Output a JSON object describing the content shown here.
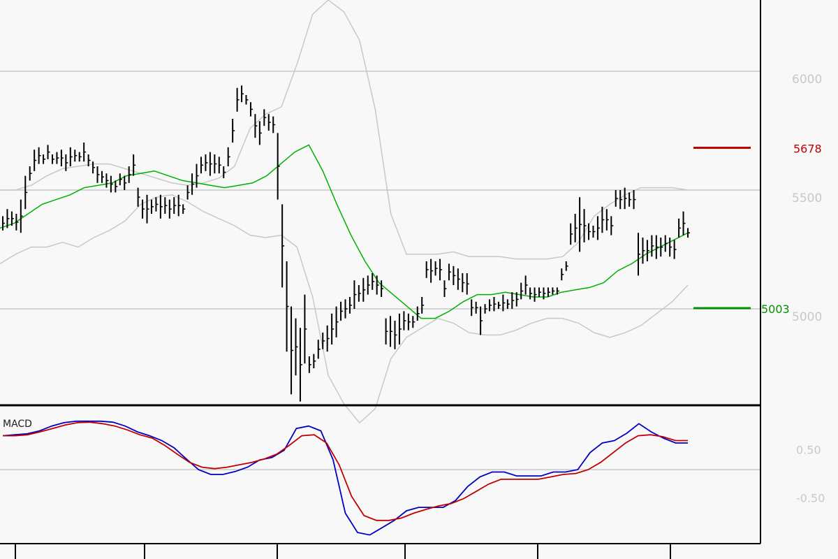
{
  "chart_data": [
    {
      "type": "ohlc",
      "title": "",
      "y_ticks": [
        "6000",
        "5500",
        "5000"
      ],
      "ylim": [
        4600,
        6300
      ],
      "levels": [
        {
          "label": "5678",
          "value": 5678,
          "color": "#c00000"
        },
        {
          "label": "5003",
          "value": 5003,
          "color": "#009000"
        }
      ],
      "bars": [
        {
          "h": 5390,
          "l": 5330
        },
        {
          "h": 5420,
          "l": 5340
        },
        {
          "h": 5410,
          "l": 5350
        },
        {
          "h": 5400,
          "l": 5330
        },
        {
          "h": 5460,
          "l": 5320
        },
        {
          "h": 5560,
          "l": 5420
        },
        {
          "h": 5600,
          "l": 5540
        },
        {
          "h": 5670,
          "l": 5580
        },
        {
          "h": 5680,
          "l": 5610
        },
        {
          "h": 5650,
          "l": 5610
        },
        {
          "h": 5690,
          "l": 5630
        },
        {
          "h": 5650,
          "l": 5610
        },
        {
          "h": 5660,
          "l": 5610
        },
        {
          "h": 5670,
          "l": 5600
        },
        {
          "h": 5650,
          "l": 5580
        },
        {
          "h": 5680,
          "l": 5600
        },
        {
          "h": 5670,
          "l": 5620
        },
        {
          "h": 5660,
          "l": 5620
        },
        {
          "h": 5700,
          "l": 5620
        },
        {
          "h": 5650,
          "l": 5600
        },
        {
          "h": 5620,
          "l": 5570
        },
        {
          "h": 5600,
          "l": 5530
        },
        {
          "h": 5580,
          "l": 5530
        },
        {
          "h": 5570,
          "l": 5510
        },
        {
          "h": 5560,
          "l": 5490
        },
        {
          "h": 5540,
          "l": 5490
        },
        {
          "h": 5570,
          "l": 5520
        },
        {
          "h": 5560,
          "l": 5500
        },
        {
          "h": 5600,
          "l": 5530
        },
        {
          "h": 5650,
          "l": 5560
        },
        {
          "h": 5510,
          "l": 5430
        },
        {
          "h": 5460,
          "l": 5380
        },
        {
          "h": 5480,
          "l": 5360
        },
        {
          "h": 5460,
          "l": 5400
        },
        {
          "h": 5470,
          "l": 5410
        },
        {
          "h": 5480,
          "l": 5380
        },
        {
          "h": 5470,
          "l": 5400
        },
        {
          "h": 5460,
          "l": 5380
        },
        {
          "h": 5470,
          "l": 5400
        },
        {
          "h": 5480,
          "l": 5390
        },
        {
          "h": 5440,
          "l": 5400
        },
        {
          "h": 5520,
          "l": 5460
        },
        {
          "h": 5570,
          "l": 5480
        },
        {
          "h": 5610,
          "l": 5510
        },
        {
          "h": 5640,
          "l": 5570
        },
        {
          "h": 5650,
          "l": 5580
        },
        {
          "h": 5660,
          "l": 5560
        },
        {
          "h": 5650,
          "l": 5570
        },
        {
          "h": 5640,
          "l": 5570
        },
        {
          "h": 5600,
          "l": 5550
        },
        {
          "h": 5680,
          "l": 5600
        },
        {
          "h": 5800,
          "l": 5700
        },
        {
          "h": 5930,
          "l": 5830
        },
        {
          "h": 5940,
          "l": 5870
        },
        {
          "h": 5900,
          "l": 5860
        },
        {
          "h": 5870,
          "l": 5810
        },
        {
          "h": 5820,
          "l": 5720
        },
        {
          "h": 5790,
          "l": 5690
        },
        {
          "h": 5840,
          "l": 5770
        },
        {
          "h": 5820,
          "l": 5750
        },
        {
          "h": 5810,
          "l": 5740
        },
        {
          "h": 5740,
          "l": 5460
        },
        {
          "h": 5440,
          "l": 5090
        },
        {
          "h": 5200,
          "l": 4820
        },
        {
          "h": 5010,
          "l": 4640
        },
        {
          "h": 4960,
          "l": 4720
        },
        {
          "h": 4920,
          "l": 4610
        },
        {
          "h": 5060,
          "l": 4770
        },
        {
          "h": 4800,
          "l": 4730
        },
        {
          "h": 4810,
          "l": 4750
        },
        {
          "h": 4870,
          "l": 4790
        },
        {
          "h": 4900,
          "l": 4830
        },
        {
          "h": 4930,
          "l": 4820
        },
        {
          "h": 4980,
          "l": 4850
        },
        {
          "h": 5010,
          "l": 4880
        },
        {
          "h": 5030,
          "l": 4950
        },
        {
          "h": 5040,
          "l": 4960
        },
        {
          "h": 5050,
          "l": 4980
        },
        {
          "h": 5120,
          "l": 5000
        },
        {
          "h": 5100,
          "l": 5030
        },
        {
          "h": 5130,
          "l": 5030
        },
        {
          "h": 5140,
          "l": 5060
        },
        {
          "h": 5150,
          "l": 5080
        },
        {
          "h": 5140,
          "l": 5060
        },
        {
          "h": 5120,
          "l": 5050
        },
        {
          "h": 4960,
          "l": 4850
        },
        {
          "h": 4970,
          "l": 4840
        },
        {
          "h": 4950,
          "l": 4830
        },
        {
          "h": 4980,
          "l": 4850
        },
        {
          "h": 4990,
          "l": 4910
        },
        {
          "h": 4980,
          "l": 4910
        },
        {
          "h": 4970,
          "l": 4920
        },
        {
          "h": 5010,
          "l": 4950
        },
        {
          "h": 5050,
          "l": 4980
        },
        {
          "h": 5200,
          "l": 5130
        },
        {
          "h": 5210,
          "l": 5110
        },
        {
          "h": 5200,
          "l": 5140
        },
        {
          "h": 5210,
          "l": 5120
        },
        {
          "h": 5120,
          "l": 5050
        },
        {
          "h": 5190,
          "l": 5120
        },
        {
          "h": 5180,
          "l": 5100
        },
        {
          "h": 5170,
          "l": 5080
        },
        {
          "h": 5150,
          "l": 5070
        },
        {
          "h": 5150,
          "l": 5060
        },
        {
          "h": 5040,
          "l": 4970
        },
        {
          "h": 5030,
          "l": 4980
        },
        {
          "h": 5010,
          "l": 4890
        },
        {
          "h": 5020,
          "l": 4980
        },
        {
          "h": 5040,
          "l": 4990
        },
        {
          "h": 5050,
          "l": 4990
        },
        {
          "h": 5030,
          "l": 5000
        },
        {
          "h": 5060,
          "l": 4990
        },
        {
          "h": 5040,
          "l": 5000
        },
        {
          "h": 5070,
          "l": 5000
        },
        {
          "h": 5070,
          "l": 5010
        },
        {
          "h": 5110,
          "l": 5040
        },
        {
          "h": 5140,
          "l": 5060
        },
        {
          "h": 5090,
          "l": 5040
        },
        {
          "h": 5090,
          "l": 5030
        },
        {
          "h": 5090,
          "l": 5050
        },
        {
          "h": 5090,
          "l": 5040
        },
        {
          "h": 5090,
          "l": 5050
        },
        {
          "h": 5090,
          "l": 5060
        },
        {
          "h": 5090,
          "l": 5060
        },
        {
          "h": 5170,
          "l": 5120
        },
        {
          "h": 5200,
          "l": 5160
        },
        {
          "h": 5360,
          "l": 5270
        },
        {
          "h": 5400,
          "l": 5280
        },
        {
          "h": 5470,
          "l": 5240
        },
        {
          "h": 5420,
          "l": 5280
        },
        {
          "h": 5360,
          "l": 5290
        },
        {
          "h": 5350,
          "l": 5300
        },
        {
          "h": 5390,
          "l": 5290
        },
        {
          "h": 5430,
          "l": 5320
        },
        {
          "h": 5420,
          "l": 5330
        },
        {
          "h": 5390,
          "l": 5310
        },
        {
          "h": 5500,
          "l": 5430
        },
        {
          "h": 5500,
          "l": 5420
        },
        {
          "h": 5510,
          "l": 5420
        },
        {
          "h": 5490,
          "l": 5430
        },
        {
          "h": 5500,
          "l": 5420
        },
        {
          "h": 5320,
          "l": 5140
        },
        {
          "h": 5300,
          "l": 5190
        },
        {
          "h": 5290,
          "l": 5200
        },
        {
          "h": 5310,
          "l": 5220
        },
        {
          "h": 5310,
          "l": 5210
        },
        {
          "h": 5300,
          "l": 5220
        },
        {
          "h": 5310,
          "l": 5240
        },
        {
          "h": 5300,
          "l": 5220
        },
        {
          "h": 5290,
          "l": 5210
        },
        {
          "h": 5380,
          "l": 5300
        },
        {
          "h": 5410,
          "l": 5310
        },
        {
          "h": 5340,
          "l": 5300
        }
      ],
      "sma": [
        5340,
        5360,
        5400,
        5440,
        5460,
        5480,
        5510,
        5520,
        5530,
        5560,
        5570,
        5580,
        5560,
        5540,
        5530,
        5520,
        5510,
        5520,
        5530,
        5560,
        5610,
        5660,
        5690,
        5580,
        5440,
        5310,
        5200,
        5110,
        5060,
        5010,
        4960,
        4960,
        4990,
        5030,
        5060,
        5060,
        5070,
        5060,
        5050,
        5050,
        5070,
        5080,
        5090,
        5110,
        5160,
        5190,
        5230,
        5260,
        5290,
        5320
      ],
      "bb_upper": [
        5500,
        5500,
        5520,
        5560,
        5590,
        5600,
        5610,
        5610,
        5590,
        5570,
        5550,
        5530,
        5520,
        5530,
        5550,
        5600,
        5760,
        5820,
        5850,
        6030,
        6240,
        6300,
        6250,
        6130,
        5840,
        5400,
        5230,
        5230,
        5230,
        5240,
        5220,
        5220,
        5220,
        5210,
        5210,
        5210,
        5220,
        5280,
        5390,
        5440,
        5480,
        5510,
        5510,
        5510,
        5500
      ],
      "bb_lower": [
        5190,
        5230,
        5260,
        5260,
        5280,
        5260,
        5300,
        5330,
        5370,
        5440,
        5470,
        5480,
        5450,
        5410,
        5380,
        5350,
        5310,
        5300,
        5310,
        5260,
        5050,
        4720,
        4600,
        4520,
        4580,
        4790,
        4880,
        4920,
        4960,
        4940,
        4900,
        4890,
        4890,
        4910,
        4940,
        4960,
        4960,
        4940,
        4900,
        4880,
        4900,
        4930,
        4980,
        5030,
        5100
      ],
      "colors": {
        "bars": "#000000",
        "sma": "#00b000",
        "bands": "#c8c8c8",
        "grid": "#c8c8c8"
      }
    },
    {
      "type": "line",
      "title": "MACD",
      "y_ticks": [
        "0.50",
        "-0.50"
      ],
      "ylim": [
        -1.5,
        1.3
      ],
      "series": [
        {
          "values": [
            0.7,
            0.72,
            0.74,
            0.8,
            0.9,
            0.97,
            1.0,
            1.0,
            1.0,
            0.98,
            0.9,
            0.78,
            0.7,
            0.6,
            0.45,
            0.22,
            0.0,
            -0.1,
            -0.1,
            -0.04,
            0.05,
            0.2,
            0.25,
            0.4,
            0.85,
            0.9,
            0.8,
            0.2,
            -0.9,
            -1.3,
            -1.35,
            -1.2,
            -1.05,
            -0.85,
            -0.78,
            -0.78,
            -0.78,
            -0.64,
            -0.35,
            -0.15,
            -0.05,
            -0.05,
            -0.13,
            -0.13,
            -0.13,
            -0.05,
            -0.05,
            0.0,
            0.35,
            0.55,
            0.6,
            0.75,
            0.95,
            0.78,
            0.65,
            0.55,
            0.55
          ],
          "color": "#0000c0"
        },
        {
          "values": [
            0.7,
            0.7,
            0.72,
            0.78,
            0.85,
            0.92,
            0.97,
            0.98,
            0.95,
            0.9,
            0.82,
            0.72,
            0.65,
            0.5,
            0.32,
            0.15,
            0.05,
            0.02,
            0.05,
            0.1,
            0.15,
            0.22,
            0.32,
            0.5,
            0.7,
            0.72,
            0.55,
            0.1,
            -0.55,
            -0.95,
            -1.05,
            -1.05,
            -1.0,
            -0.9,
            -0.82,
            -0.75,
            -0.7,
            -0.6,
            -0.45,
            -0.3,
            -0.2,
            -0.2,
            -0.2,
            -0.2,
            -0.15,
            -0.1,
            -0.08,
            0.0,
            0.15,
            0.35,
            0.55,
            0.7,
            0.72,
            0.68,
            0.6,
            0.6
          ],
          "color": "#c00000"
        }
      ],
      "colors": {
        "grid": "#c8c8c8"
      }
    }
  ]
}
